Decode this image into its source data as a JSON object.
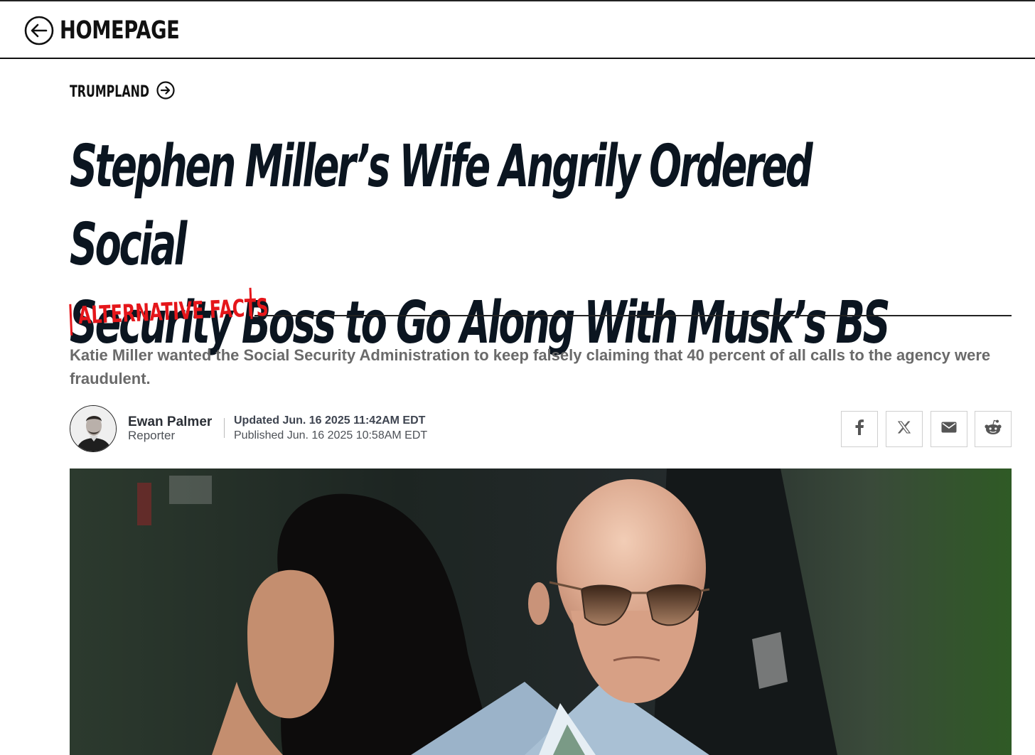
{
  "header": {
    "back_label": "HOMEPAGE"
  },
  "section": {
    "label": "TRUMPLAND"
  },
  "article": {
    "headline_line1": "Stephen Miller’s Wife Angrily Ordered Social",
    "headline_line2": "Security Boss to Go Along With Musk’s BS",
    "kicker": "ALTERNATIVE FACTS",
    "dek": "Katie Miller wanted the Social Security Administration to keep falsely claiming that 40 percent of all calls to the agency were fraudulent."
  },
  "byline": {
    "author_name": "Ewan Palmer",
    "author_role": "Reporter",
    "updated": "Updated Jun. 16 2025 11:42AM EDT",
    "published": "Published Jun. 16 2025 10:58AM EDT"
  },
  "share": {
    "buttons": [
      "facebook-icon",
      "x-icon",
      "email-icon",
      "reddit-icon"
    ]
  },
  "colors": {
    "accent_red": "#e5161a",
    "headline": "#0b1520",
    "dek_gray": "#6a6a6a"
  }
}
